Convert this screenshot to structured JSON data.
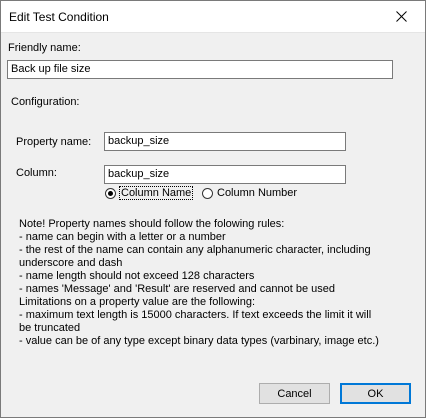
{
  "window": {
    "title": "Edit Test Condition",
    "close_icon": "close-icon"
  },
  "form": {
    "friendly_name_label": "Friendly name:",
    "friendly_name_value": "Back up file size",
    "configuration_label": "Configuration:",
    "property_name_label": "Property name:",
    "property_name_value": "backup_size",
    "column_label": "Column:",
    "column_value": "backup_size",
    "radio_column_name": "Column Name",
    "radio_column_number": "Column Number",
    "selected_radio": "Column Name"
  },
  "note": {
    "lines": [
      "Note! Property names should follow the folowing rules:",
      "- name can begin with a letter or a number",
      "- the rest of the name can contain any alphanumeric character, including",
      "underscore and dash",
      "- name length should not exceed 128 characters",
      "- names 'Message' and 'Result' are reserved and cannot be used",
      "Limitations on a property value are the following:",
      "- maximum text length is 15000 characters. If text exceeds the limit it will",
      "be truncated",
      "- value can be of any type except binary data types (varbinary, image etc.)"
    ]
  },
  "buttons": {
    "cancel_label": "Cancel",
    "ok_label": "OK"
  },
  "colors": {
    "dialog_bg": "#f0f0f0",
    "default_button_border": "#0078d7"
  }
}
